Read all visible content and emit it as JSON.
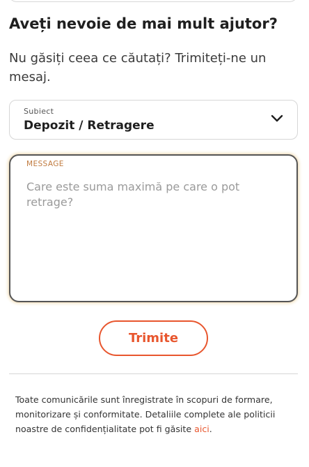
{
  "help": {
    "title": "Aveți nevoie de mai mult ajutor?",
    "subtitle": "Nu găsiți ceea ce căutați? Trimiteți-ne un mesaj."
  },
  "subject_select": {
    "label": "Subiect",
    "value": "Depozit / Retragere"
  },
  "message": {
    "label": "MESSAGE",
    "placeholder": "Care este suma maximă pe care o pot retrage?"
  },
  "submit_label": "Trimite",
  "disclaimer": {
    "text": "Toate comunicările sunt înregistrate în scopuri de formare, monitorizare și conformitate. Detaliile complete ale politicii noastre de confidențialitate pot fi găsite ",
    "link_text": "aici",
    "trailing": "."
  },
  "colors": {
    "accent": "#e8562e",
    "label_accent": "#c07a3e"
  },
  "icons": {
    "select_arrow": "chevron-down-icon"
  }
}
